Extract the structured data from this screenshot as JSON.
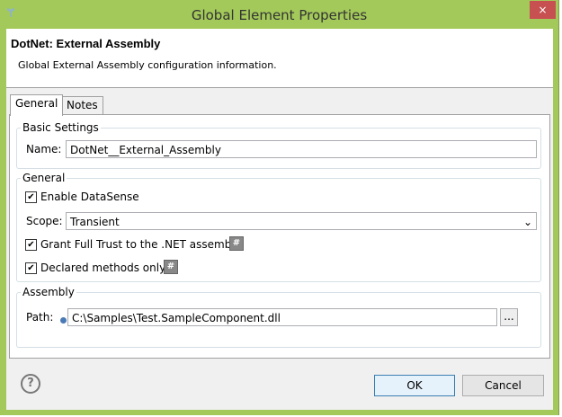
{
  "window": {
    "title": "Global Element Properties",
    "close_icon": "×"
  },
  "header": {
    "title": "DotNet: External Assembly",
    "description": "Global External Assembly configuration information."
  },
  "tabs": [
    {
      "label": "General",
      "active": true
    },
    {
      "label": "Notes",
      "active": false
    }
  ],
  "basic": {
    "label": "Basic Settings",
    "name_label": "Name:",
    "name_value": "DotNet__External_Assembly"
  },
  "general": {
    "label": "General",
    "enable_datasense": "Enable DataSense",
    "enable_checked": true,
    "scope_label": "Scope:",
    "scope_value": "Transient",
    "grant_trust": "Grant Full Trust to the .NET assembly",
    "grant_checked": true,
    "declared": "Declared methods only",
    "declared_checked": true
  },
  "assembly": {
    "label": "Assembly",
    "path_label": "Path:",
    "path_value": "C:\\Samples\\Test.SampleComponent.dll",
    "browse": "..."
  },
  "buttons": {
    "ok": "OK",
    "cancel": "Cancel",
    "help": "?"
  }
}
